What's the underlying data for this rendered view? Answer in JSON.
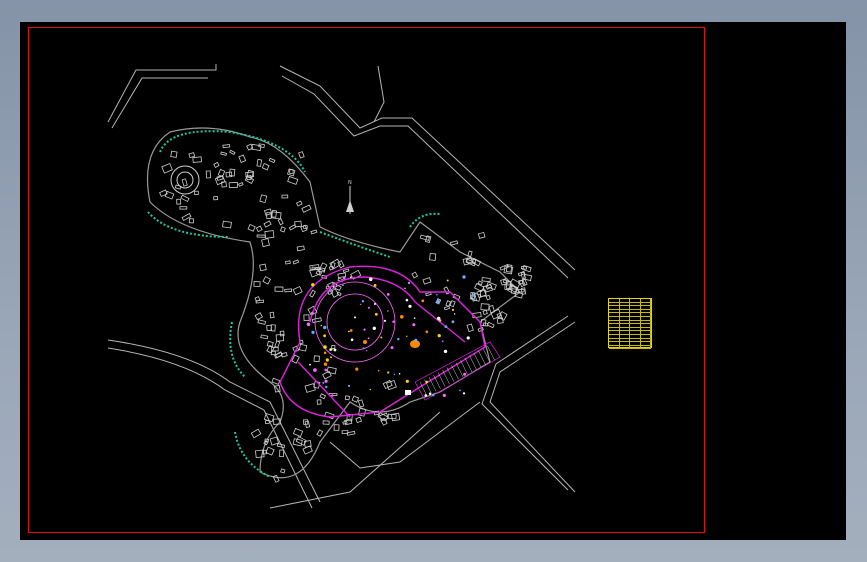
{
  "app": {
    "title": "",
    "background": "#8fa0b3",
    "canvas_color": "#000000"
  },
  "drawing": {
    "frame_color": "#dd1111",
    "layer_colors": {
      "road": "#b9b9b9",
      "green_edge": "#22c7a0",
      "building": "#d8d8d8",
      "highlight": "#e020e0",
      "accent": "#ff8a00",
      "table": "#e6d800"
    }
  },
  "north_arrow": {
    "label": "N"
  },
  "legend_table": {
    "title": "",
    "rows": 14
  }
}
